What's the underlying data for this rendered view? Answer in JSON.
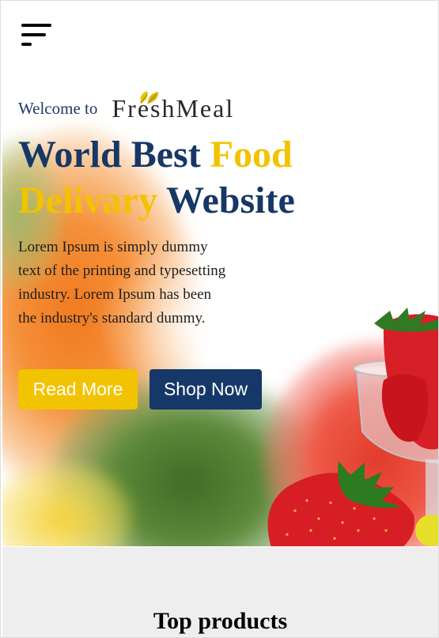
{
  "header": {
    "menu_icon": "hamburger-menu-icon"
  },
  "hero": {
    "welcome_text": "Welcome to",
    "logo_text": "FreshMeal",
    "logo_icon": "leaf-icon",
    "headline": {
      "part1": "World Best ",
      "part2": "Food",
      "part3": "Delivary",
      "part4": " Website"
    },
    "description": "Lorem Ipsum is simply dummy text of the printing and typesetting industry. Lorem Ipsum has been the industry's standard dummy.",
    "read_more_label": "Read More",
    "shop_now_label": "Shop Now"
  },
  "products": {
    "title": "Top products"
  },
  "colors": {
    "navy": "#173766",
    "yellow": "#f2c300",
    "section_bg": "#eeeeee"
  }
}
